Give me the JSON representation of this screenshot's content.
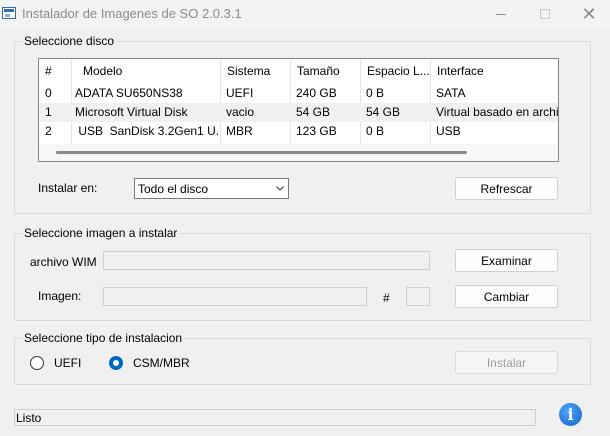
{
  "window": {
    "title": "Instalador de Imagenes de SO 2.0.3.1"
  },
  "disk_group": {
    "title": "Seleccione disco",
    "columns": [
      "#",
      "Modelo",
      "Sistema",
      "Tamaño",
      "Espacio L...",
      "Interface"
    ],
    "rows": [
      [
        "0",
        "ADATA SU650NS38",
        "UEFI",
        "240 GB",
        "0 B",
        "SATA"
      ],
      [
        "1",
        "Microsoft Virtual Disk",
        "vacio",
        "54 GB",
        "54 GB",
        "Virtual basado en archivo"
      ],
      [
        "2",
        " USB  SanDisk 3.2Gen1 U...",
        "MBR",
        "123 GB",
        "0 B",
        "USB"
      ]
    ],
    "install_label": "Instalar en:",
    "install_value": "Todo el disco",
    "refresh_label": "Refrescar"
  },
  "image_group": {
    "title": "Seleccione imagen a instalar",
    "wim_label": "archivo WIM",
    "wim_value": "",
    "browse_label": "Examinar",
    "image_label": "Imagen:",
    "image_value": "",
    "hash_label": "#",
    "index_value": "",
    "change_label": "Cambiar"
  },
  "install_group": {
    "title": "Seleccione tipo de instalacion",
    "options": [
      "UEFI",
      "CSM/MBR"
    ],
    "selected": "CSM/MBR",
    "install_label": "Instalar"
  },
  "status": {
    "text": "Listo"
  },
  "icons": {
    "info": "info-icon",
    "app": "app-icon",
    "dropdown": "chevron-down-icon"
  },
  "colors": {
    "accent": "#0067c0",
    "info": "#1e88e5"
  }
}
